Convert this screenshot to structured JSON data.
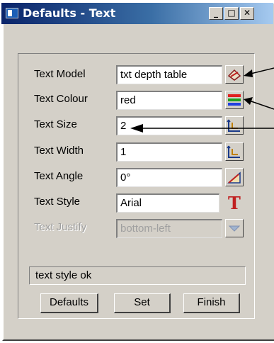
{
  "window": {
    "title": "Defaults - Text",
    "minimize_label": "_",
    "maximize_label": "□",
    "close_label": "✕"
  },
  "fields": [
    {
      "label": "Text Model",
      "value": "txt depth table",
      "icon": "model-select-icon",
      "enabled": true
    },
    {
      "label": "Text Colour",
      "value": "red",
      "icon": "colour-bars-icon",
      "enabled": true
    },
    {
      "label": "Text Size",
      "value": "2",
      "icon": "size-pick-icon",
      "enabled": true
    },
    {
      "label": "Text Width",
      "value": "1",
      "icon": "width-pick-icon",
      "enabled": true
    },
    {
      "label": "Text Angle",
      "value": "0°",
      "icon": "angle-pick-icon",
      "enabled": true
    },
    {
      "label": "Text Style",
      "value": "Arial",
      "icon": "font-T-icon",
      "enabled": true
    },
    {
      "label": "Text Justify",
      "value": "bottom-left",
      "icon": "dropdown-arrow-icon",
      "enabled": false
    }
  ],
  "status_text": "text style ok",
  "buttons": {
    "defaults": "Defaults",
    "set": "Set",
    "finish": "Finish"
  },
  "colors": {
    "title_bar": "#0a246a",
    "dialog_face": "#d4d0c8",
    "style_icon": "#c02020"
  }
}
